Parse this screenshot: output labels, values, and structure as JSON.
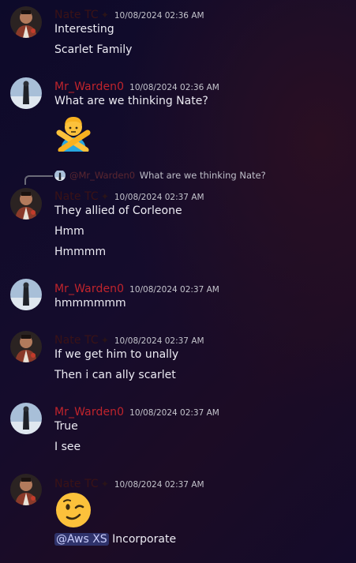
{
  "messages": [
    {
      "author": "Nate TC",
      "author_badge": "✦",
      "timestamp": "10/08/2024 02:36 AM",
      "lines": [
        "Interesting",
        "Scarlet Family"
      ]
    },
    {
      "author": "Mr_Warden0",
      "timestamp": "10/08/2024 02:36 AM",
      "lines": [
        "What are we thinking Nate?"
      ],
      "emoji": "person-gesturing-no-emoji"
    },
    {
      "reply": {
        "mention": "@Mr_Warden0",
        "content": "What are we thinking Nate?"
      },
      "author": "Nate TC",
      "author_badge": "✦",
      "timestamp": "10/08/2024 02:37 AM",
      "lines": [
        "They allied of Corleone",
        "Hmm",
        "Hmmmm"
      ]
    },
    {
      "author": "Mr_Warden0",
      "timestamp": "10/08/2024 02:37 AM",
      "lines": [
        "hmmmmmm"
      ]
    },
    {
      "author": "Nate TC",
      "author_badge": "✦",
      "timestamp": "10/08/2024 02:37 AM",
      "lines": [
        "If we get him to unally",
        "Then i can ally scarlet"
      ]
    },
    {
      "author": "Mr_Warden0",
      "timestamp": "10/08/2024 02:37 AM",
      "lines": [
        "True",
        "I see"
      ]
    },
    {
      "author": "Nate TC",
      "author_badge": "✦",
      "timestamp": "10/08/2024 02:37 AM",
      "emoji": "winking-face-emoji",
      "mention": "@Aws XS",
      "text_after_mention": "Incorporate"
    }
  ]
}
